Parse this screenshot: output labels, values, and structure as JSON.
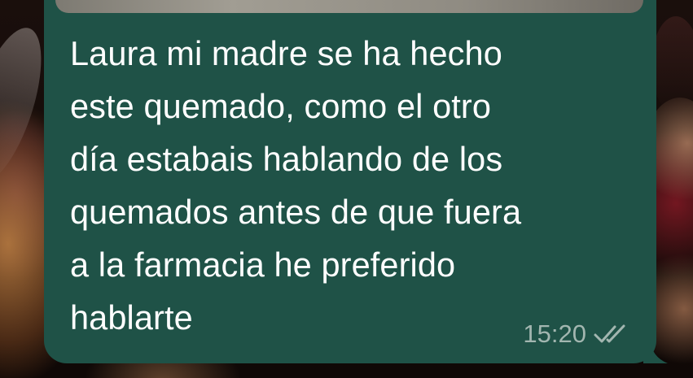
{
  "message": {
    "lines": [
      "Laura mi madre se ha hecho",
      "este quemado, como el otro",
      "día estabais hablando de los",
      "quemados antes de que fuera",
      "a la farmacia he preferido",
      "hablarte"
    ],
    "time": "15:20",
    "status_icon": "double-check-icon",
    "direction": "outgoing"
  },
  "colors": {
    "bubble": "#1f5247",
    "text": "#ffffff",
    "meta": "#a2b6b0"
  }
}
